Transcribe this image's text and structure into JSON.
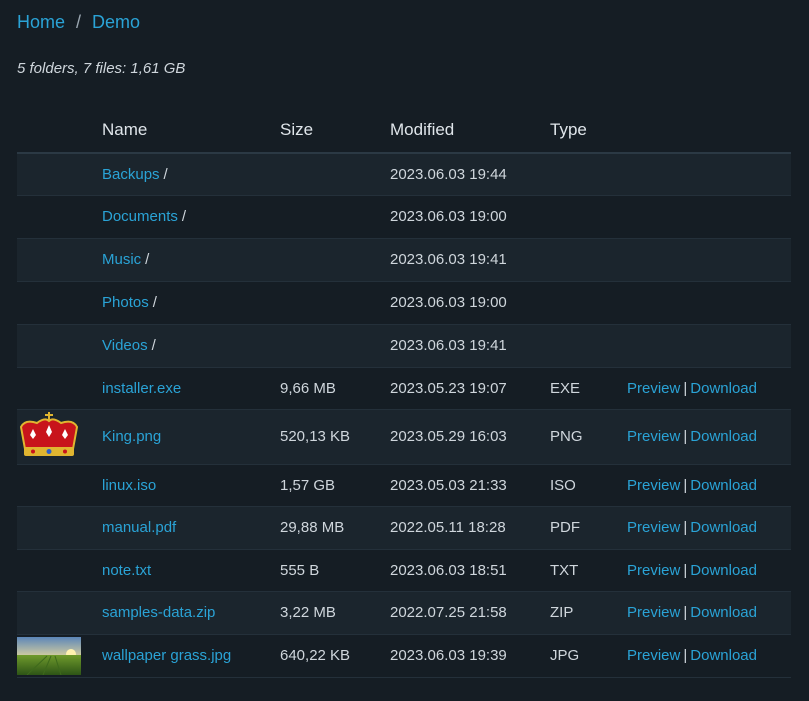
{
  "breadcrumb": {
    "home": "Home",
    "separator": "/",
    "current": "Demo"
  },
  "summary": "5 folders, 7 files: 1,61 GB",
  "columns": {
    "name": "Name",
    "size": "Size",
    "modified": "Modified",
    "type": "Type"
  },
  "actions": {
    "preview": "Preview",
    "separator": "|",
    "download": "Download"
  },
  "folder_suffix": "/",
  "folders": [
    {
      "name": "Backups",
      "modified": "2023.06.03 19:44"
    },
    {
      "name": "Documents",
      "modified": "2023.06.03 19:00"
    },
    {
      "name": "Music",
      "modified": "2023.06.03 19:41"
    },
    {
      "name": "Photos",
      "modified": "2023.06.03 19:00"
    },
    {
      "name": "Videos",
      "modified": "2023.06.03 19:41"
    }
  ],
  "files": [
    {
      "name": "installer.exe",
      "size": "9,66 MB",
      "modified": "2023.05.23 19:07",
      "type": "EXE"
    },
    {
      "name": "King.png",
      "size": "520,13 KB",
      "modified": "2023.05.29 16:03",
      "type": "PNG"
    },
    {
      "name": "linux.iso",
      "size": "1,57 GB",
      "modified": "2023.05.03 21:33",
      "type": "ISO"
    },
    {
      "name": "manual.pdf",
      "size": "29,88 MB",
      "modified": "2022.05.11 18:28",
      "type": "PDF"
    },
    {
      "name": "note.txt",
      "size": "555 B",
      "modified": "2023.06.03 18:51",
      "type": "TXT"
    },
    {
      "name": "samples-data.zip",
      "size": "3,22 MB",
      "modified": "2022.07.25 21:58",
      "type": "ZIP"
    },
    {
      "name": "wallpaper grass.jpg",
      "size": "640,22 KB",
      "modified": "2023.06.03 19:39",
      "type": "JPG"
    }
  ],
  "colors": {
    "background": "#151d24",
    "row_alt": "#1b252d",
    "link": "#2aa3d6",
    "text": "#cfd6dc"
  }
}
